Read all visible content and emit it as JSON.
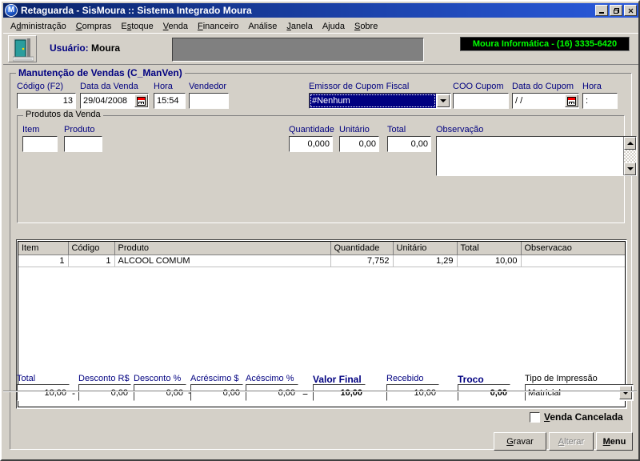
{
  "window": {
    "title": "Retaguarda - SisMoura :: Sistema Integrado Moura",
    "icon": "app-logo-icon",
    "minimize": "_",
    "maximize": "❐",
    "close": "✕"
  },
  "menubar": [
    {
      "label": "Administração",
      "accel": "d"
    },
    {
      "label": "Compras",
      "accel": "C"
    },
    {
      "label": "Estoque",
      "accel": "s"
    },
    {
      "label": "Venda",
      "accel": "V"
    },
    {
      "label": "Financeiro",
      "accel": "F"
    },
    {
      "label": "Análise",
      "accel": ""
    },
    {
      "label": "Janela",
      "accel": "J"
    },
    {
      "label": "Ajuda",
      "accel": ""
    },
    {
      "label": "Sobre",
      "accel": "S"
    }
  ],
  "toolbar": {
    "door_icon": "exit-door-icon",
    "user_label": "Usuário:",
    "user_name": "Moura",
    "led_text": "Moura Informática - (16) 3335-6420",
    "led_color": "#00ff00"
  },
  "form": {
    "group_title": "Manutenção de Vendas (C_ManVen)",
    "codigo_label": "Código (F2)",
    "codigo_value": "13",
    "data_venda_label": "Data da Venda",
    "data_venda_value": "29/04/2008",
    "hora_label": "Hora",
    "hora_value": "15:54",
    "vendedor_label": "Vendedor",
    "vendedor_value": "",
    "emissor_label": "Emissor de Cupom Fiscal",
    "emissor_value": "#Nenhum",
    "coo_label": "COO Cupom",
    "coo_value": "",
    "data_cupom_label": "Data do Cupom",
    "data_cupom_value": "/   /",
    "hora_cupom_label": "Hora",
    "hora_cupom_value": ":"
  },
  "produtos": {
    "group_title": "Produtos da Venda",
    "item_label": "Item",
    "item_value": "",
    "produto_label": "Produto",
    "produto_value": "",
    "quantidade_label": "Quantidade",
    "quantidade_value": "0,000",
    "unitario_label": "Unitário",
    "unitario_value": "0,00",
    "total_label": "Total",
    "total_value": "0,00",
    "observacao_label": "Observação",
    "observacao_value": ""
  },
  "grid": {
    "columns": [
      "Item",
      "Código",
      "Produto",
      "Quantidade",
      "Unitário",
      "Total",
      "Observacao"
    ],
    "rows": [
      {
        "item": "1",
        "codigo": "1",
        "produto": "ALCOOL COMUM",
        "quantidade": "7,752",
        "unitario": "1,29",
        "total": "10,00",
        "observacao": ""
      }
    ]
  },
  "totals": {
    "total_label": "Total",
    "total_value": "10,00",
    "op_minus": "-",
    "desconto_rs_label": "Desconto R$",
    "desconto_rs_value": "0,00",
    "desconto_pc_label": "Desconto %",
    "desconto_pc_value": "0,00",
    "op_plus": "+",
    "acrescimo_label": "Acréscimo $",
    "acrescimo_value": "0,00",
    "acescimo_pc_label": "Acéscimo %",
    "acescimo_pc_value": "0,00",
    "op_equals": "=",
    "valor_final_label": "Valor Final",
    "valor_final_value": "10,00",
    "recebido_label": "Recebido",
    "recebido_value": "10,00",
    "troco_label": "Troco",
    "troco_value": "0,00",
    "tipo_impressao_label": "Tipo de Impressão",
    "tipo_impressao_value": "Matricial"
  },
  "footer": {
    "venda_cancelada_label": "Venda Cancelada",
    "venda_cancelada_checked": false,
    "gravar_label": "Gravar",
    "alterar_label": "Alterar",
    "alterar_disabled": true,
    "menu_label": "Menu"
  }
}
